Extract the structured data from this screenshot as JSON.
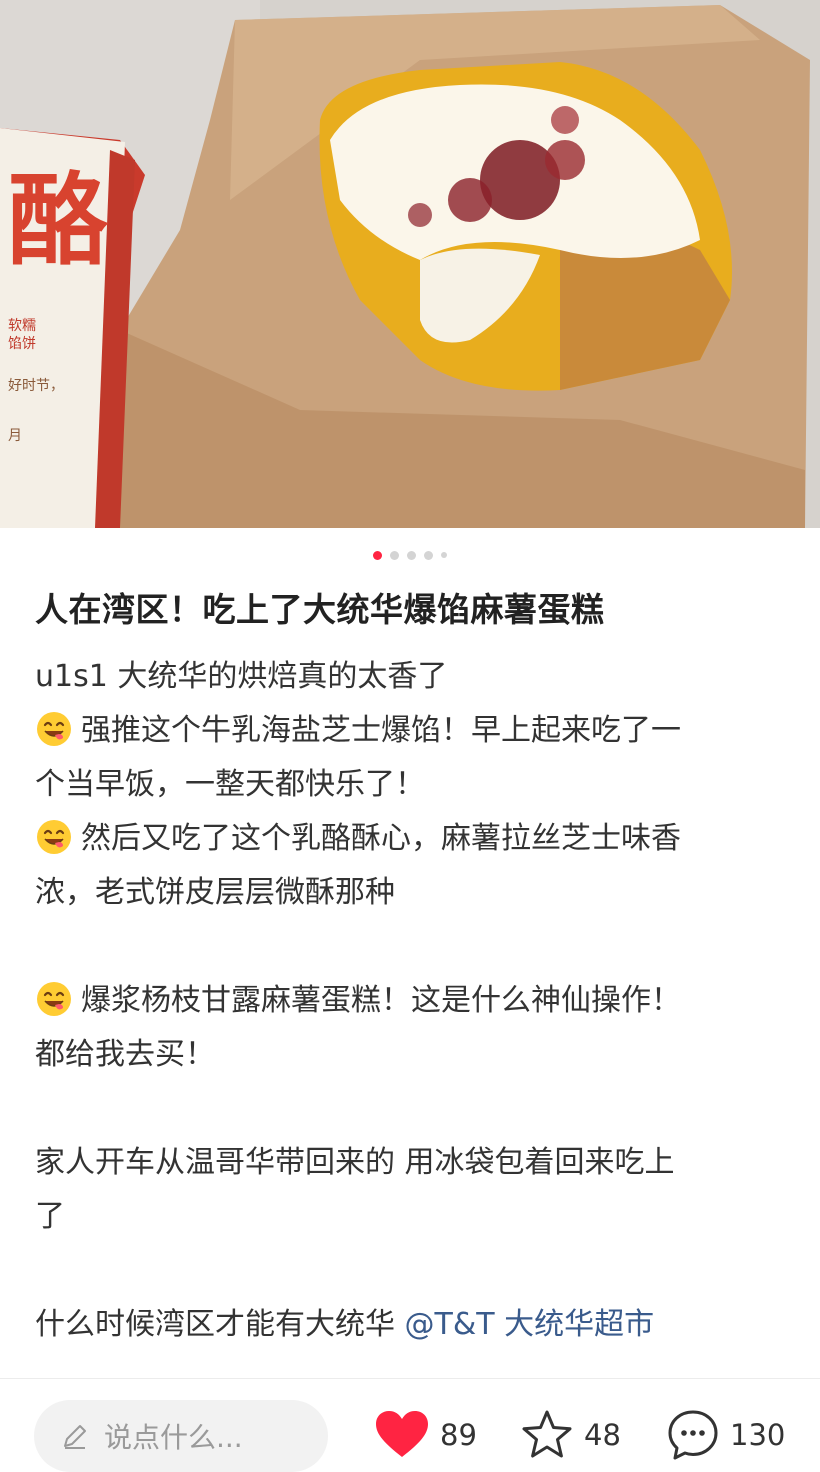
{
  "photo": {
    "package_glyph": "酪",
    "package_small_text": [
      "软糯",
      "馅饼",
      "好时节，",
      "月"
    ],
    "slide_count": 5,
    "active_slide": 1
  },
  "post": {
    "title": "人在湾区！吃上了大统华爆馅麻薯蛋糕",
    "lines": [
      {
        "emoji": false,
        "text": "u1s1 大统华的烘焙真的太香了"
      },
      {
        "emoji": true,
        "text": "强推这个牛乳海盐芝士爆馅！早上起来吃了一"
      },
      {
        "emoji": false,
        "text": "个当早饭，一整天都快乐了！"
      },
      {
        "emoji": true,
        "text": "然后又吃了这个乳酪酥心，麻薯拉丝芝士味香"
      },
      {
        "emoji": false,
        "text": "浓，老式饼皮层层微酥那种"
      },
      {
        "emoji": false,
        "text": ""
      },
      {
        "emoji": true,
        "text": "爆浆杨枝甘露麻薯蛋糕！这是什么神仙操作！"
      },
      {
        "emoji": false,
        "text": "都给我去买！"
      },
      {
        "emoji": false,
        "text": ""
      },
      {
        "emoji": false,
        "text": "家人开车从温哥华带回来的 用冰袋包着回来吃上"
      },
      {
        "emoji": false,
        "text": "了"
      },
      {
        "emoji": false,
        "text": ""
      }
    ],
    "last_line": "什么时候湾区才能有大统华",
    "mention": "@T&T 大统华超市"
  },
  "bottom_bar": {
    "comment_placeholder": "说点什么...",
    "likes": "89",
    "stars": "48",
    "comments": "130"
  },
  "colors": {
    "accent": "#ff2442",
    "mention": "#3a5b8c"
  },
  "icons": [
    "pencil-icon",
    "heart-icon",
    "star-icon",
    "comment-bubble-icon",
    "smiley-emoji-icon"
  ]
}
